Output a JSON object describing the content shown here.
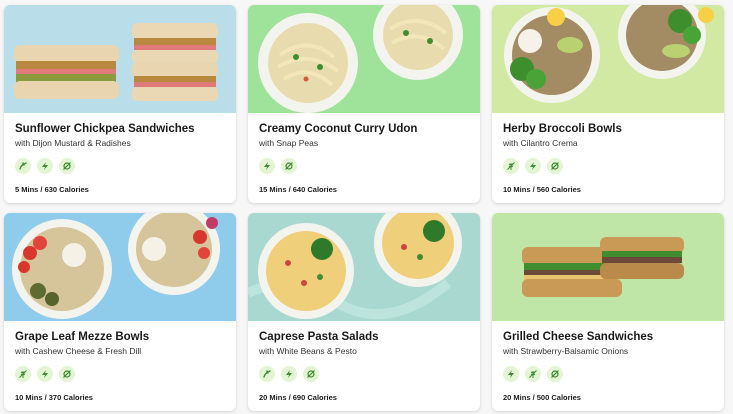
{
  "cards": [
    {
      "title": "Sunflower Chickpea Sandwiches",
      "subtitle": "with Dijon Mustard & Radishes",
      "meta": "5 Mins / 630 Calories",
      "tags": [
        "spicy",
        "quick",
        "low-sodium"
      ],
      "bg": "#b9dde9"
    },
    {
      "title": "Creamy Coconut Curry Udon",
      "subtitle": "with Snap Peas",
      "meta": "15 Mins / 640 Calories",
      "tags": [
        "quick",
        "low-sodium"
      ],
      "bg": "#9fe39a"
    },
    {
      "title": "Herby Broccoli Bowls",
      "subtitle": "with Cilantro Crema",
      "meta": "10 Mins / 560 Calories",
      "tags": [
        "no-wheat",
        "quick",
        "low-sodium"
      ],
      "bg": "#d2e9a4"
    },
    {
      "title": "Grape Leaf Mezze Bowls",
      "subtitle": "with Cashew Cheese & Fresh Dill",
      "meta": "10 Mins / 370 Calories",
      "tags": [
        "no-wheat",
        "quick",
        "low-sodium"
      ],
      "bg": "#8fcbea"
    },
    {
      "title": "Caprese Pasta Salads",
      "subtitle": "with White Beans & Pesto",
      "meta": "20 Mins / 690 Calories",
      "tags": [
        "spicy",
        "quick",
        "low-sodium"
      ],
      "bg": "#a8d8cf"
    },
    {
      "title": "Grilled Cheese Sandwiches",
      "subtitle": "with Strawberry-Balsamic Onions",
      "meta": "20 Mins / 500 Calories",
      "tags": [
        "quick",
        "no-wheat",
        "low-sodium"
      ],
      "bg": "#bfe6a6"
    }
  ],
  "colors": {
    "tag_bg": "#e3f5d4",
    "tag_icon": "#3d8b2f"
  }
}
